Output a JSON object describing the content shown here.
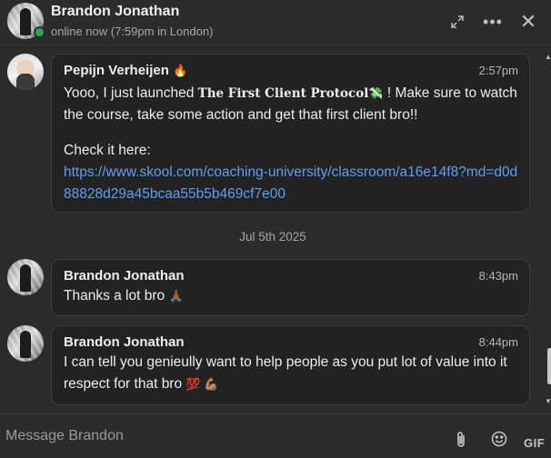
{
  "header": {
    "name": "Brandon Jonathan",
    "status": "online now (7:59pm in London)",
    "more_glyph": "•••",
    "close_glyph": "✕"
  },
  "messages": [
    {
      "sender": "Pepijn Verheijen",
      "sender_emoji": "🔥",
      "time": "2:57pm",
      "text_before": "Yooo, I just launched ",
      "highlight": "The First Client Protocol",
      "highlight_emoji": "💸",
      "text_after": " ! Make sure to watch the course, take some action and get that first client bro!!",
      "text2": "Check it here:",
      "link": "https://www.skool.com/coaching-university/classroom/a16e14f8?md=d0d88828d29a45bcaa55b5b469cf7e00"
    },
    {
      "sender": "Brandon Jonathan",
      "time": "8:43pm",
      "text": "Thanks a lot bro",
      "emoji": "🙏🏾"
    },
    {
      "sender": "Brandon Jonathan",
      "time": "8:44pm",
      "text": "I can tell you genieully want to help people as you put lot of value into it respect for that bro",
      "emoji": "💯 💪🏽"
    }
  ],
  "date_separator": "Jul 5th 2025",
  "composer": {
    "placeholder": "Message Brandon",
    "gif_label": "GIF"
  },
  "colors": {
    "background": "#2b2b2b",
    "bubble": "#222222",
    "link": "#5f9ef5",
    "online": "#2ea44f"
  }
}
